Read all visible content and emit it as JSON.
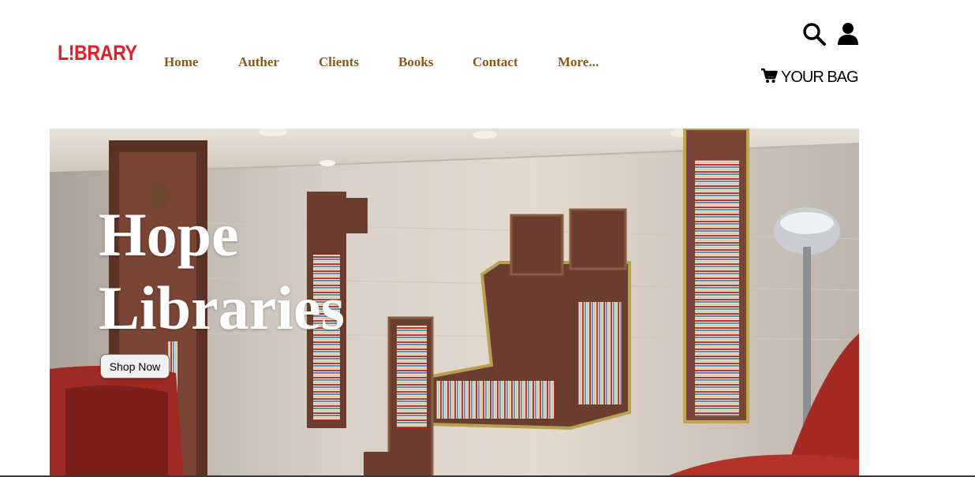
{
  "header": {
    "logo_text": "L!BRARY",
    "nav": [
      {
        "label": "Home"
      },
      {
        "label": "Auther"
      },
      {
        "label": "Clients"
      },
      {
        "label": "Books"
      },
      {
        "label": "Contact"
      },
      {
        "label": "More..."
      }
    ],
    "icons": {
      "search": "search-icon",
      "user": "user-icon",
      "cart": "cart-icon"
    },
    "bag_label": "YOUR BAG"
  },
  "hero": {
    "title_line1": "Hope",
    "title_line2": "Libraries",
    "cta_label": "Shop Now",
    "image": "bookshelf-room-photo"
  },
  "colors": {
    "brand": "#e41e26",
    "nav_text": "#8a5a14",
    "hero_text": "#ffffff"
  }
}
